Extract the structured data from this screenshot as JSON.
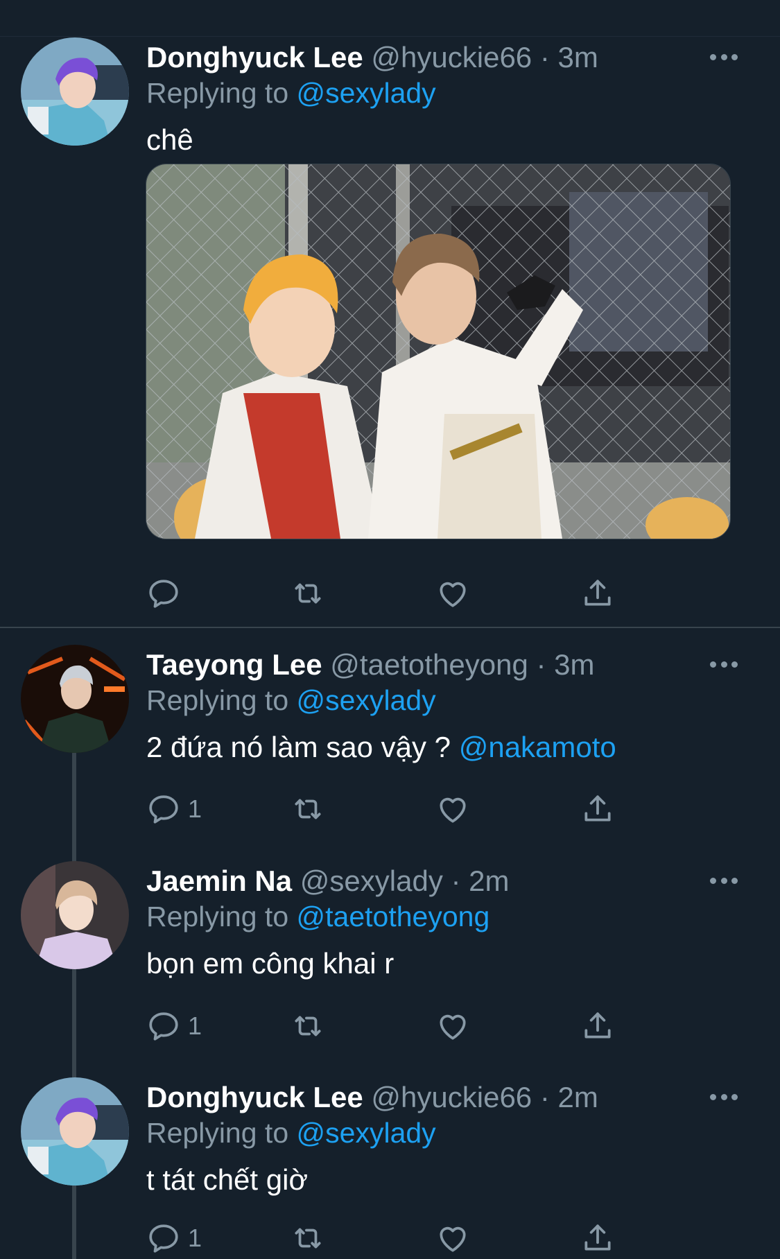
{
  "colors": {
    "background": "#15202b",
    "text_primary": "#ffffff",
    "text_secondary": "#8899a6",
    "accent": "#1da1f2",
    "divider": "#38444d"
  },
  "tweets": [
    {
      "name": "Donghyuck Lee",
      "handle": "@hyuckie66",
      "separator": "·",
      "time": "3m",
      "replying_prefix": "Replying to",
      "replying_to": "@sexylady",
      "text": "chê",
      "text_mention": "",
      "avatar_icon": "avatar-purple-hair",
      "has_media": true,
      "reply_count": "",
      "actions": [
        "reply-icon",
        "retweet-icon",
        "like-icon",
        "share-icon"
      ]
    },
    {
      "name": "Taeyong Lee",
      "handle": "@taetotheyong",
      "separator": "·",
      "time": "3m",
      "replying_prefix": "Replying to",
      "replying_to": "@sexylady",
      "text": "2 đứa nó làm sao vậy ?",
      "text_mention": "@nakamoto",
      "avatar_icon": "avatar-dark-neon",
      "has_media": false,
      "reply_count": "1",
      "actions": [
        "reply-icon",
        "retweet-icon",
        "like-icon",
        "share-icon"
      ]
    },
    {
      "name": "Jaemin Na",
      "handle": "@sexylady",
      "separator": "·",
      "time": "2m",
      "replying_prefix": "Replying to",
      "replying_to": "@taetotheyong",
      "text": "bọn em công khai r",
      "text_mention": "",
      "avatar_icon": "avatar-light-hair",
      "has_media": false,
      "reply_count": "1",
      "actions": [
        "reply-icon",
        "retweet-icon",
        "like-icon",
        "share-icon"
      ]
    },
    {
      "name": "Donghyuck Lee",
      "handle": "@hyuckie66",
      "separator": "·",
      "time": "2m",
      "replying_prefix": "Replying to",
      "replying_to": "@sexylady",
      "text": "t tát chết giờ",
      "text_mention": "",
      "avatar_icon": "avatar-purple-hair",
      "has_media": false,
      "reply_count": "1",
      "actions": [
        "reply-icon",
        "retweet-icon",
        "like-icon",
        "share-icon"
      ]
    }
  ]
}
